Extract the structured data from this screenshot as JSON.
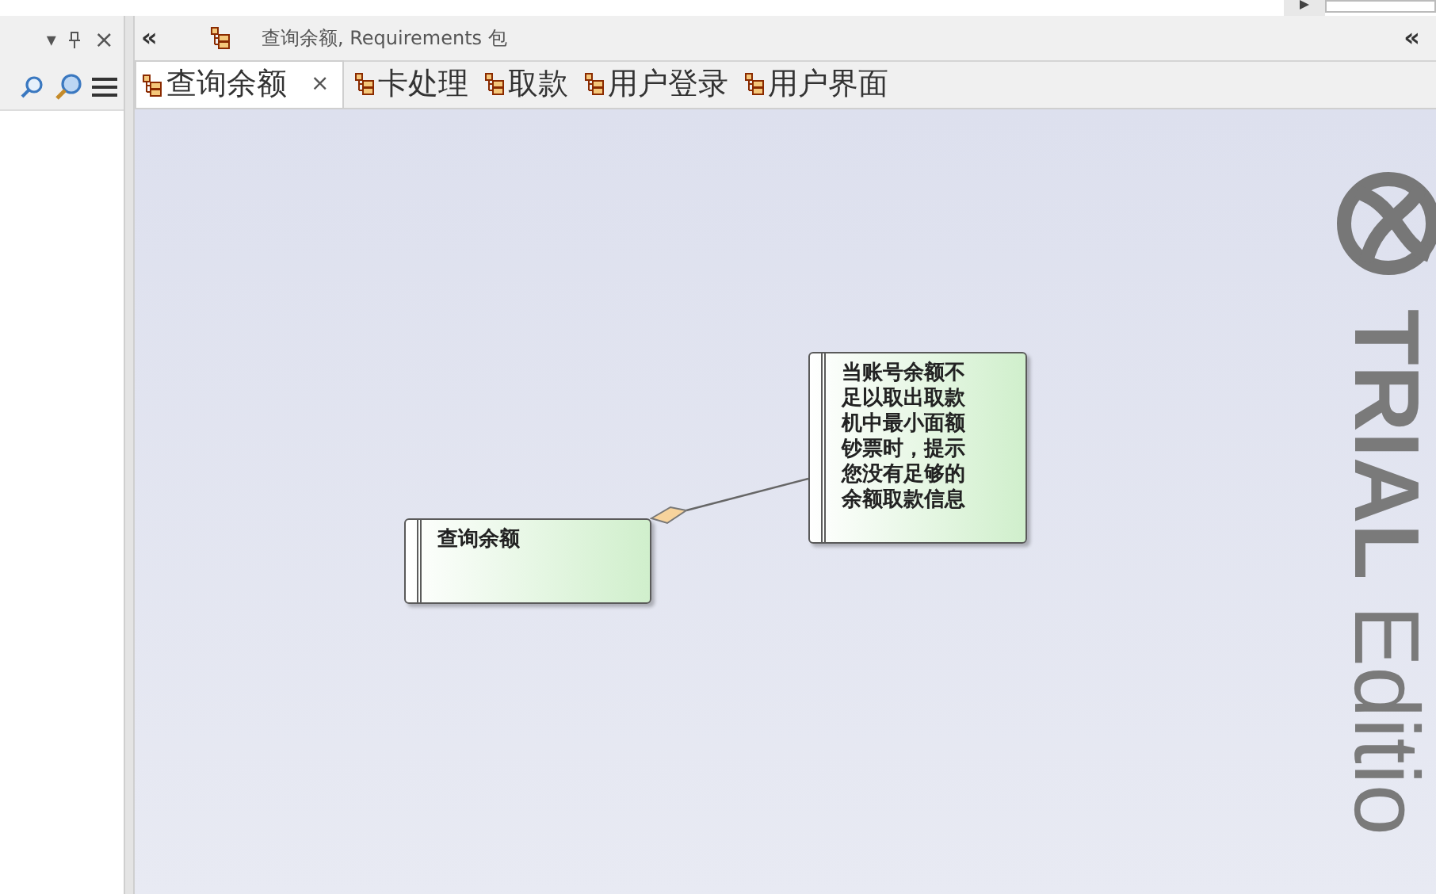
{
  "left_panel": {
    "header_icons": [
      "▾",
      "×"
    ]
  },
  "diagram_header": {
    "collapse": "«",
    "title": "查询余额, Requirements 包",
    "expand": "«"
  },
  "tabs": [
    {
      "label": "查询余额",
      "selected": true,
      "close": "×"
    },
    {
      "label": "卡处理",
      "selected": false
    },
    {
      "label": "取款",
      "selected": false
    },
    {
      "label": "用户登录",
      "selected": false
    },
    {
      "label": "用户界面",
      "selected": false
    }
  ],
  "diagram": {
    "elements": [
      {
        "kind": "requirement",
        "text": "查询余额"
      },
      {
        "kind": "requirement",
        "text": "当账号余额不足以取出取款机中最小面额钞票时，提示您没有足够的余额取款信息"
      }
    ],
    "watermark": "TRIAL Editio"
  }
}
